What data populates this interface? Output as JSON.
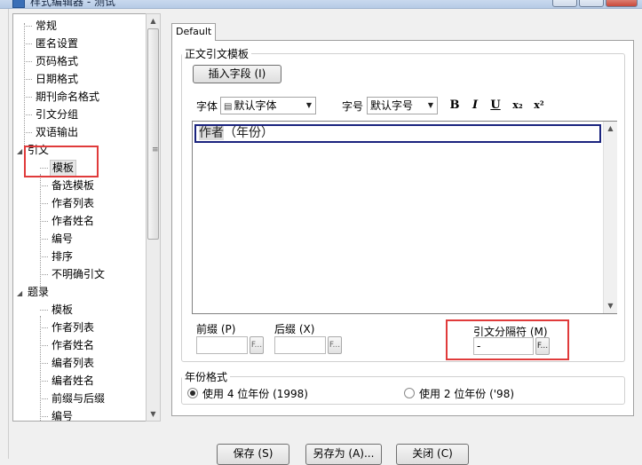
{
  "window": {
    "title": "样式编辑器 - 测试"
  },
  "tree": {
    "items": [
      {
        "label": "常规",
        "level": 0
      },
      {
        "label": "匿名设置",
        "level": 0
      },
      {
        "label": "页码格式",
        "level": 0
      },
      {
        "label": "日期格式",
        "level": 0
      },
      {
        "label": "期刊命名格式",
        "level": 0
      },
      {
        "label": "引文分组",
        "level": 0
      },
      {
        "label": "双语输出",
        "level": 0
      },
      {
        "label": "引文",
        "level": 0,
        "expanded": true
      },
      {
        "label": "模板",
        "level": 1,
        "selected": true
      },
      {
        "label": "备选模板",
        "level": 1
      },
      {
        "label": "作者列表",
        "level": 1
      },
      {
        "label": "作者姓名",
        "level": 1
      },
      {
        "label": "编号",
        "level": 1
      },
      {
        "label": "排序",
        "level": 1
      },
      {
        "label": "不明确引文",
        "level": 1
      },
      {
        "label": "题录",
        "level": 0,
        "expanded": true
      },
      {
        "label": "模板",
        "level": 1
      },
      {
        "label": "作者列表",
        "level": 1
      },
      {
        "label": "作者姓名",
        "level": 1
      },
      {
        "label": "编者列表",
        "level": 1
      },
      {
        "label": "编者姓名",
        "level": 1
      },
      {
        "label": "前缀与后缀",
        "level": 1
      },
      {
        "label": "编号",
        "level": 1
      }
    ]
  },
  "tab": {
    "label": "Default"
  },
  "template_group": {
    "legend": "正文引文模板",
    "insert_button": "插入字段 (I)",
    "font_label": "字体",
    "font_value": "默认字体",
    "size_label": "字号",
    "size_value": "默认字号",
    "bold": "B",
    "italic": "I",
    "underline": "U",
    "subscript": "x₂",
    "superscript": "x²",
    "editor_text_author": "作者",
    "editor_text_rest": "（年份）"
  },
  "affixes": {
    "prefix_label": "前缀 (P)",
    "suffix_label": "后缀 (X)",
    "separator_label": "引文分隔符 (M)",
    "separator_value": "-",
    "field_button": "F..."
  },
  "year_format": {
    "legend": "年份格式",
    "option_4": "使用 4 位年份 (1998)",
    "option_2": "使用 2 位年份 ('98)",
    "selected": "option_4"
  },
  "footer": {
    "save": "保存 (S)",
    "save_as": "另存为 (A)...",
    "close": "关闭 (C)"
  },
  "colors": {
    "highlight_border": "#e03b3b",
    "active_line_border": "#1a237e"
  }
}
